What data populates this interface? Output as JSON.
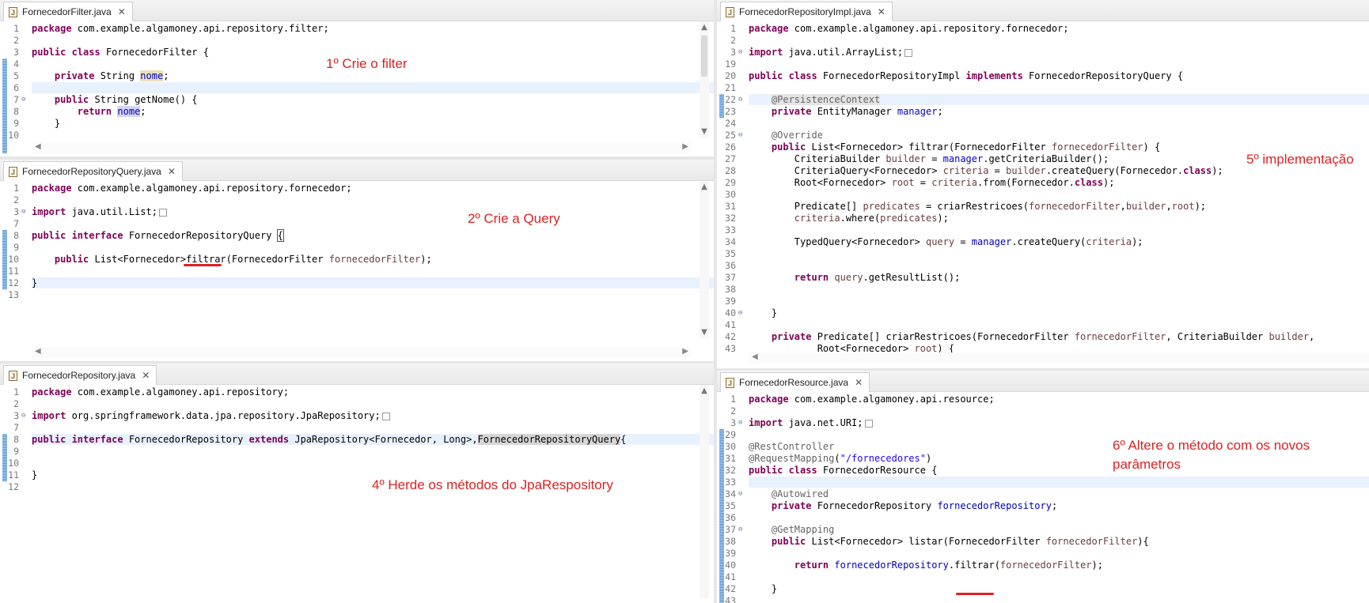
{
  "panes": {
    "filter": {
      "tab_title": "FornecedorFilter.java",
      "note": "1º Crie o filter",
      "lines": [
        {
          "n": "1",
          "code": "<span class='kw'>package</span> com.example.algamoney.api.repository.filter;"
        },
        {
          "n": "2",
          "code": ""
        },
        {
          "n": "3",
          "code": "<span class='kw'>public class</span> FornecedorFilter {"
        },
        {
          "n": "4",
          "code": ""
        },
        {
          "n": "5",
          "code": "    <span class='kw'>private</span> String <span class='fld occ'>nome</span>;"
        },
        {
          "n": "6",
          "code": ""
        },
        {
          "n": "7",
          "code": "    <span class='kw'>public</span> String getNome() {"
        },
        {
          "n": "8",
          "code": "        <span class='kw'>return</span> <span class='fld occ2'>nome</span>;"
        },
        {
          "n": "9",
          "code": "    }"
        },
        {
          "n": "10",
          "code": ""
        }
      ]
    },
    "query": {
      "tab_title": "FornecedorRepositoryQuery.java",
      "note": "2º Crie a Query",
      "lines": [
        {
          "n": "1",
          "code": "<span class='kw'>package</span> com.example.algamoney.api.repository.fornecedor;"
        },
        {
          "n": "2",
          "code": ""
        },
        {
          "n": "3",
          "code": "<span class='kw'>import</span> java.util.List;<span class='fold-box'></span>"
        },
        {
          "n": "7",
          "code": ""
        },
        {
          "n": "8",
          "code": "<span class='kw'>public interface</span> FornecedorRepositoryQuery <span class='cursorbox'>{</span>"
        },
        {
          "n": "9",
          "code": ""
        },
        {
          "n": "10",
          "code": "    <span class='kw'>public</span> List&lt;Fornecedor&gt;filtrar(FornecedorFilter <span class='par'>fornecedorFilter</span>);"
        },
        {
          "n": "11",
          "code": ""
        },
        {
          "n": "12",
          "code": "}"
        },
        {
          "n": "13",
          "code": ""
        }
      ]
    },
    "repo": {
      "tab_title": "FornecedorRepository.java",
      "note": "4º Herde os métodos do JpaRespository",
      "lines": [
        {
          "n": "1",
          "code": "<span class='kw'>package</span> com.example.algamoney.api.repository;"
        },
        {
          "n": "2",
          "code": ""
        },
        {
          "n": "3",
          "code": "<span class='kw'>import</span> org.springframework.data.jpa.repository.JpaRepository;<span class='fold-box'></span>"
        },
        {
          "n": "7",
          "code": ""
        },
        {
          "n": "8",
          "code": "<span class='kw'>public interface</span> FornecedorRepository <span class='kw'>extends</span> JpaRepository&lt;Fornecedor, Long&gt;,<span style='background:#d6d6d6'>FornecedorRepositoryQuery</span>{"
        },
        {
          "n": "9",
          "code": ""
        },
        {
          "n": "10",
          "code": ""
        },
        {
          "n": "11",
          "code": "}"
        },
        {
          "n": "12",
          "code": ""
        }
      ]
    },
    "impl": {
      "tab_title": "FornecedorRepositoryImpl.java",
      "note": "5º implementação",
      "lines": [
        {
          "n": "1",
          "code": "<span class='kw'>package</span> com.example.algamoney.api.repository.fornecedor;"
        },
        {
          "n": "2",
          "code": ""
        },
        {
          "n": "3",
          "code": "<span class='kw'>import</span> java.util.ArrayList;<span class='fold-box'></span>"
        },
        {
          "n": "19",
          "code": ""
        },
        {
          "n": "20",
          "code": "<span class='kw'>public class</span> FornecedorRepositoryImpl <span class='kw'>implements</span> FornecedorRepositoryQuery {"
        },
        {
          "n": "21",
          "code": ""
        },
        {
          "n": "22",
          "code": "    <span class='ann' style='background:#e4e4e4'>@PersistenceContext</span>"
        },
        {
          "n": "23",
          "code": "    <span class='kw'>private</span> EntityManager <span class='fld'>manager</span>;"
        },
        {
          "n": "24",
          "code": ""
        },
        {
          "n": "25",
          "code": "    <span class='ann'>@Override</span>"
        },
        {
          "n": "26",
          "code": "    <span class='kw'>public</span> List&lt;Fornecedor&gt; filtrar(FornecedorFilter <span class='par'>fornecedorFilter</span>) {"
        },
        {
          "n": "27",
          "code": "        CriteriaBuilder <span class='par'>builder</span> = <span class='fld'>manager</span>.getCriteriaBuilder();"
        },
        {
          "n": "28",
          "code": "        CriteriaQuery&lt;Fornecedor&gt; <span class='par'>criteria</span> = <span class='par'>builder</span>.createQuery(Fornecedor.<span class='kw'>class</span>);"
        },
        {
          "n": "29",
          "code": "        Root&lt;Fornecedor&gt; <span class='par'>root</span> = <span class='par'>criteria</span>.from(Fornecedor.<span class='kw'>class</span>);"
        },
        {
          "n": "30",
          "code": ""
        },
        {
          "n": "31",
          "code": "        Predicate[] <span class='par'>predicates</span> = criarRestricoes(<span class='par'>fornecedorFilter</span>,<span class='par'>builder</span>,<span class='par'>root</span>);"
        },
        {
          "n": "32",
          "code": "        <span class='par'>criteria</span>.where(<span class='par'>predicates</span>);"
        },
        {
          "n": "33",
          "code": ""
        },
        {
          "n": "34",
          "code": "        TypedQuery&lt;Fornecedor&gt; <span class='par'>query</span> = <span class='fld'>manager</span>.createQuery(<span class='par'>criteria</span>);"
        },
        {
          "n": "35",
          "code": ""
        },
        {
          "n": "36",
          "code": ""
        },
        {
          "n": "37",
          "code": "        <span class='kw'>return</span> <span class='par'>query</span>.getResultList();"
        },
        {
          "n": "38",
          "code": ""
        },
        {
          "n": "39",
          "code": ""
        },
        {
          "n": "40",
          "code": "    }"
        },
        {
          "n": "41",
          "code": ""
        },
        {
          "n": "42",
          "code": "    <span class='kw'>private</span> Predicate[] criarRestricoes(FornecedorFilter <span class='par'>fornecedorFilter</span>, CriteriaBuilder <span class='par'>builder</span>,"
        },
        {
          "n": "43",
          "code": "            Root&lt;Fornecedor&gt; <span class='par'>root</span>) {"
        }
      ]
    },
    "resource": {
      "tab_title": "FornecedorResource.java",
      "note_line1": "6º Altere o método com os novos",
      "note_line2": "parâmetros",
      "lines": [
        {
          "n": "1",
          "code": "<span class='kw'>package</span> com.example.algamoney.api.resource;"
        },
        {
          "n": "2",
          "code": ""
        },
        {
          "n": "3",
          "code": "<span class='kw'>import</span> java.net.URI;<span class='fold-box'></span>"
        },
        {
          "n": "29",
          "code": ""
        },
        {
          "n": "30",
          "code": "<span class='ann'>@RestController</span>"
        },
        {
          "n": "31",
          "code": "<span class='ann'>@RequestMapping</span>(<span class='str'>\"/fornecedores\"</span>)"
        },
        {
          "n": "32",
          "code": "<span class='kw'>public class</span> FornecedorResource {"
        },
        {
          "n": "33",
          "code": ""
        },
        {
          "n": "34",
          "code": "    <span class='ann'>@Autowired</span>"
        },
        {
          "n": "35",
          "code": "    <span class='kw'>private</span> FornecedorRepository <span class='fld'>fornecedorRepository</span>;"
        },
        {
          "n": "36",
          "code": ""
        },
        {
          "n": "37",
          "code": "    <span class='ann'>@GetMapping</span>"
        },
        {
          "n": "38",
          "code": "    <span class='kw'>public</span> List&lt;Fornecedor&gt; listar(FornecedorFilter <span class='par'>fornecedorFilter</span>){"
        },
        {
          "n": "39",
          "code": ""
        },
        {
          "n": "40",
          "code": "        <span class='kw'>return</span> <span class='fld'>fornecedorRepository</span>.filtrar(<span class='par'>fornecedorFilter</span>);"
        },
        {
          "n": "41",
          "code": ""
        },
        {
          "n": "42",
          "code": "    }"
        },
        {
          "n": "43",
          "code": ""
        }
      ]
    }
  },
  "colors": {
    "annotation_note": "#e02020",
    "keyword": "#7f0055",
    "string": "#2a00ff",
    "field": "#0000c0",
    "current_line": "#e8f2fe"
  },
  "icons": {
    "file": "java-file-icon",
    "close": "close-icon",
    "fold": "fold-toggle-icon"
  }
}
